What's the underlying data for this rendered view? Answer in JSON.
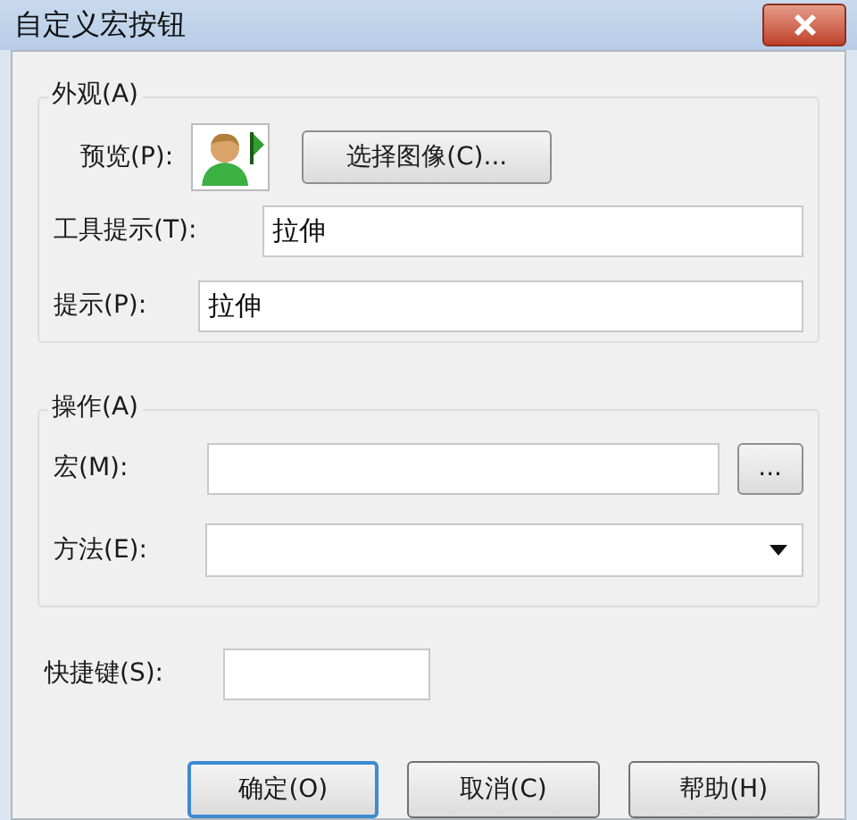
{
  "window": {
    "title": "自定义宏按钮"
  },
  "appearance": {
    "title": "外观(A)",
    "preview_label": "预览(P):",
    "choose_image_button": "选择图像(C)...",
    "tooltip": {
      "label": "工具提示(T):",
      "value": "拉伸"
    },
    "hint": {
      "label": "提示(P):",
      "value": "拉伸"
    }
  },
  "action": {
    "title": "操作(A)",
    "macro_label": "宏(M):",
    "browse_button": "...",
    "method_label": "方法(E):"
  },
  "shortcut": {
    "label": "快捷键(S):"
  },
  "buttons": [
    {
      "label": "确定(O)",
      "selected": true
    },
    {
      "label": "取消(C)",
      "selected": false
    },
    {
      "label": "帮助(H)",
      "selected": false
    }
  ]
}
